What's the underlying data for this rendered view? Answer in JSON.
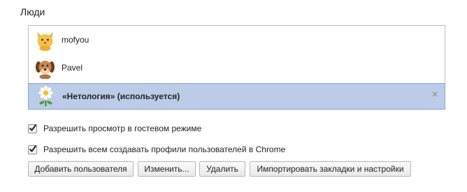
{
  "section": {
    "title": "Люди"
  },
  "people": [
    {
      "name": "mofyou",
      "avatar": "cat-avatar-icon",
      "selected": false
    },
    {
      "name": "Pavel",
      "avatar": "dog-avatar-icon",
      "selected": false
    },
    {
      "name": "«Нетология» (используется)",
      "avatar": "daisy-avatar-icon",
      "selected": true,
      "remove_symbol": "×"
    }
  ],
  "options": [
    {
      "label": "Разрешить просмотр в гостевом режиме",
      "checked": true
    },
    {
      "label": "Разрешить всем создавать профили пользователей в Chrome",
      "checked": true
    }
  ],
  "buttons": {
    "add": "Добавить пользователя",
    "edit": "Изменить...",
    "delete": "Удалить",
    "import": "Импортировать закладки и настройки"
  },
  "colors": {
    "selected_row": "#bccce8",
    "selected_border": "#8aa6d4"
  }
}
